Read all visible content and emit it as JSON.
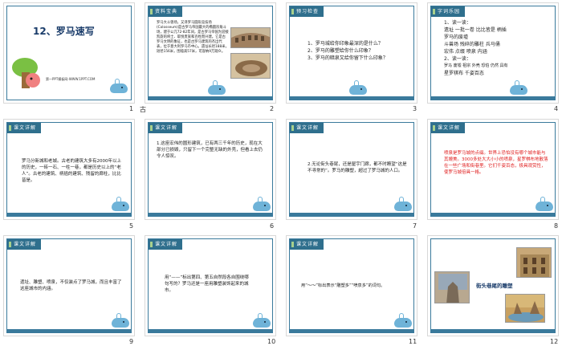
{
  "slides": [
    {
      "number": "1",
      "title": "12、罗马速写",
      "footer": "第一PPT模板网-WWW.1PPT.COM"
    },
    {
      "number": "2",
      "tag": "资料宝典",
      "side": "古",
      "text": "罗马大斗兽场，又译罗马圆形竞技场(Colosseum)是古罗马帝国最大的椭圆形角斗场，建于公元72-82年间，是古罗马帝国为迎接凯旋的将士、取悦贵族和百姓而兴建。它是古罗马文明的象征，也是古罗马建筑的杰出代表，位于意大利罗马市中心。遗址长径188米，短径156米，围墙高57米，可容纳9万观众。"
    },
    {
      "number": "3",
      "tag": "预习检查",
      "lines": [
        "1、罗马城给你印象最深的是什么？",
        "2、罗马的雕塑给你什么印象？",
        "3、罗马的暗泉又给你留下什么印象？"
      ]
    },
    {
      "number": "4",
      "tag": "字词乐园",
      "lines": [
        "1、读一读：",
        "遗址  一批一卷  比比皆是  柄插",
        "罗马的废墟",
        "斗兽场  残碎的雕柱  兵马俑",
        "宏伟  点缀  喷泉  内涵",
        "2、读一读：",
        "罗马  废墟  祖宗  外壳  恐怕  仍然  具有",
        "星罗棋布  千姿百态"
      ]
    },
    {
      "number": "5",
      "tag": "课文详解",
      "text": "罗马分新城和老城。古老的建筑大多有2000年以上的历史，一砖一石、一柱一巷，都是历史以上的“老人”。古老的建筑、柄插的建筑、残留的廊柱，比比皆是。"
    },
    {
      "number": "6",
      "tag": "课文详解",
      "text": "1.这座宏伟的圆形建筑，已有两三千年的历史，现在大部分已损毁，只留下一个完整无缺的外壳，但看上去仍令人惊叹。"
    },
    {
      "number": "7",
      "tag": "课文详解",
      "text": "2.无论街头巷尾，还是屋宇门廊，都不时瞭望“这是不寻常的”。罗马的雕塑，超过了罗马城的人口。"
    },
    {
      "number": "8",
      "tag": "课文详解",
      "text": "喷泉是罗马城的点缀。世界上恐怕没有哪个城市能与其媲美。3000多处大大小小的喷泉，星罗棋布地散落在一些广场和街巷里。它们千姿百态，极具观赏性，使罗马城倍具一格。"
    },
    {
      "number": "9",
      "tag": "课文详解",
      "text": "遗址、雕塑、喷泉，不仅装点了罗马城，而且丰富了这座城市的内涵。"
    },
    {
      "number": "10",
      "tag": "课文详解",
      "text": "用“——”标出第四、第五自然段各自围绕哪句写的？罗马还是一座用雕塑装饰起来的城市。"
    },
    {
      "number": "11",
      "tag": "课文详解",
      "text": "用“～～”标出表示“雕塑多”“喷泉多”的词句。"
    },
    {
      "number": "12",
      "caption": "街头巷尾的雕塑"
    }
  ]
}
